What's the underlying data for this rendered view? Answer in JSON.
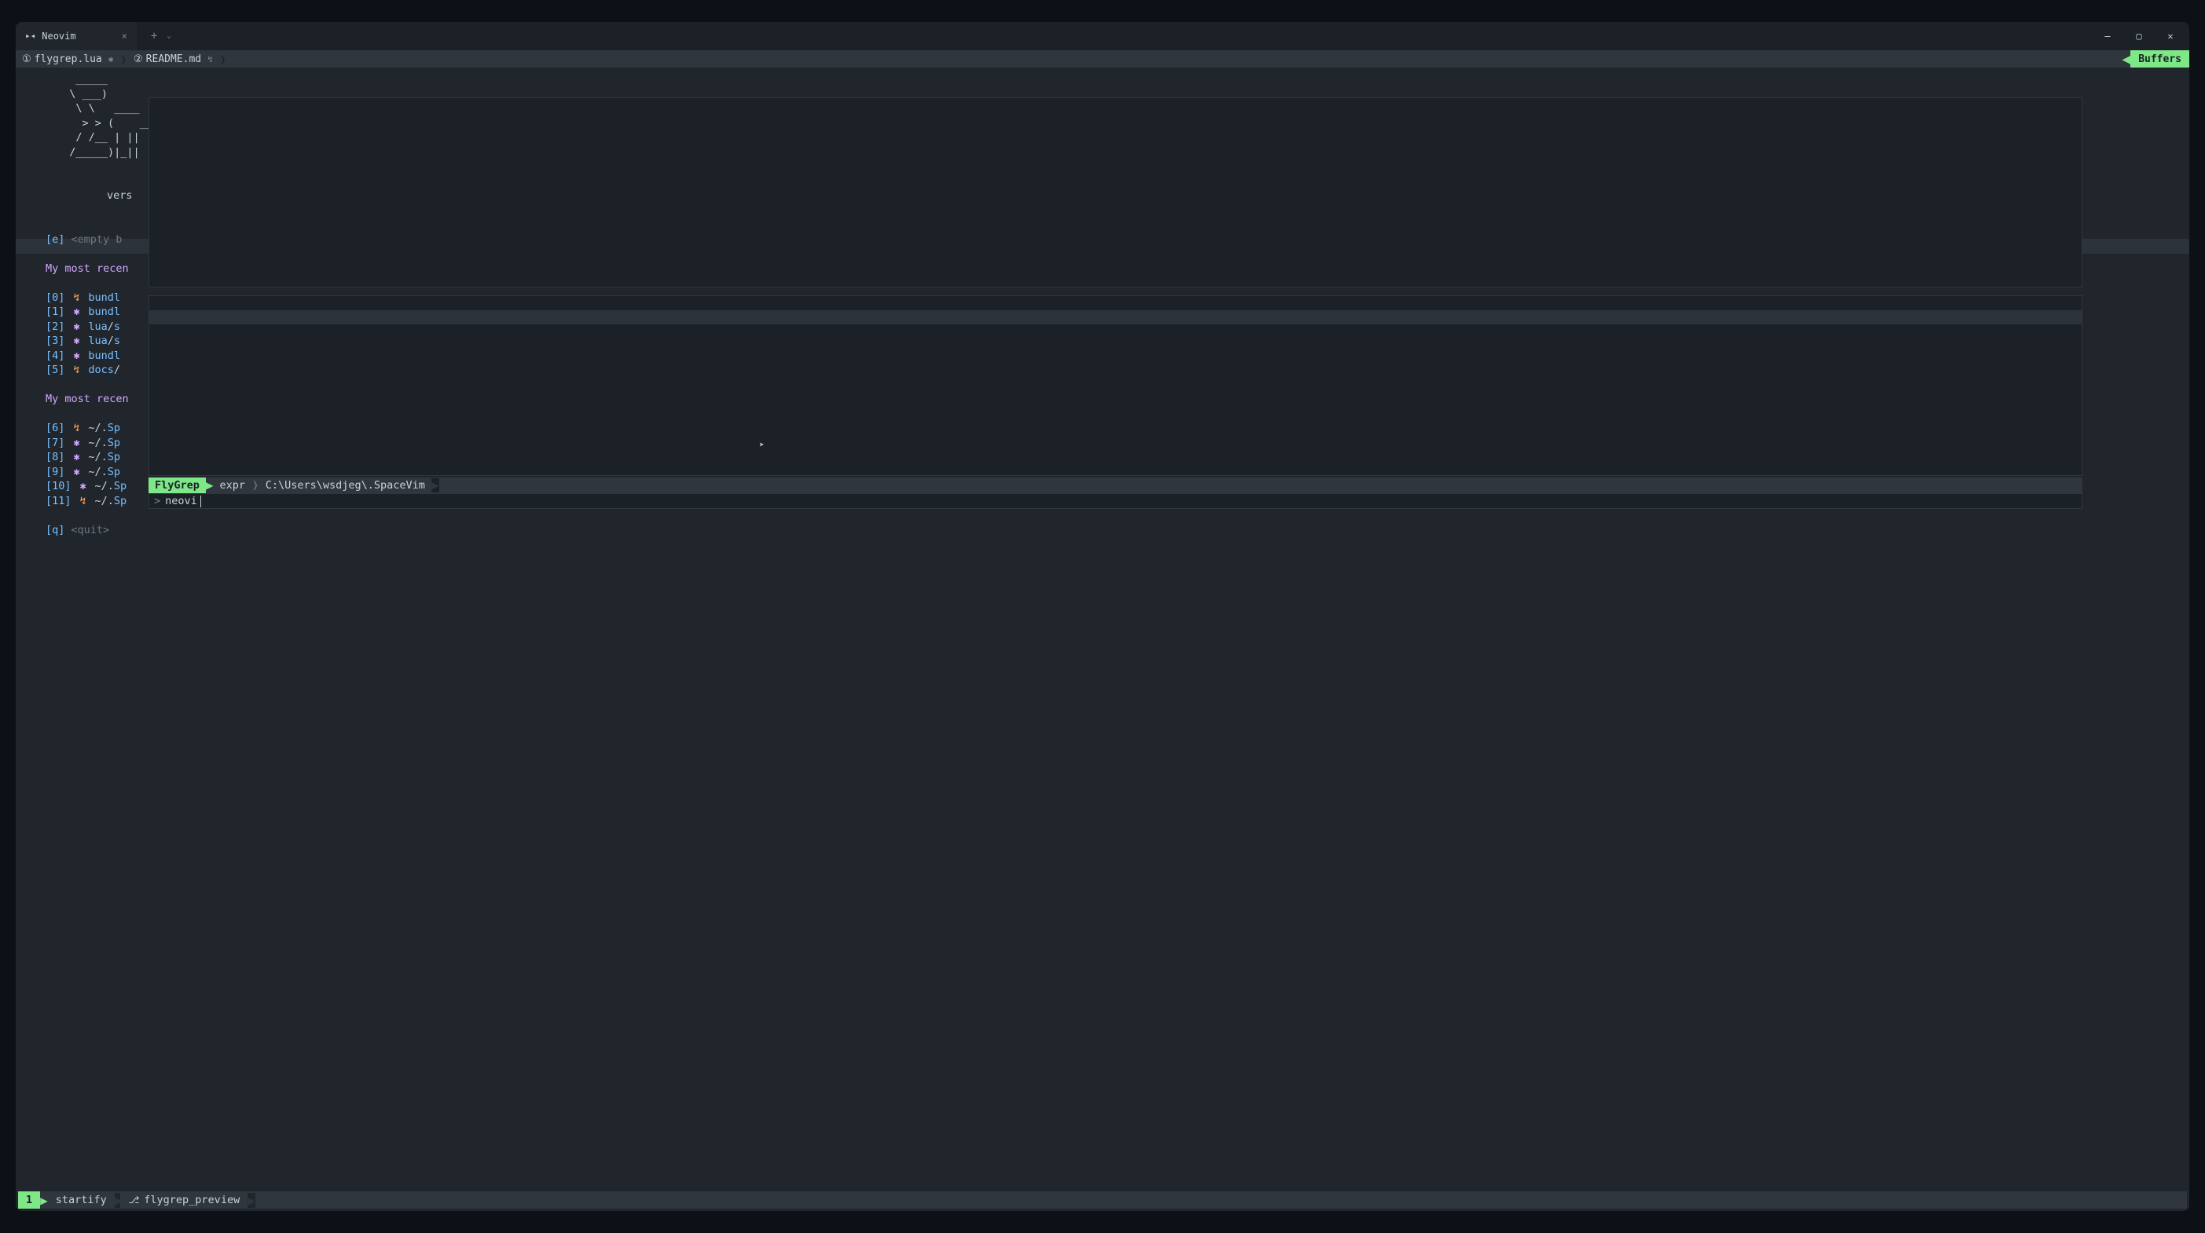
{
  "titlebar": {
    "app_name": "Neovim",
    "close_glyph": "×",
    "new_tab_glyph": "+",
    "dropdown_glyph": "⌄"
  },
  "window_controls": {
    "minimize": "—",
    "maximize": "▢",
    "close": "✕"
  },
  "bufferline": {
    "items": [
      {
        "num": "①",
        "name": "flygrep.lua",
        "modified": "✱"
      },
      {
        "num": "②",
        "name": "README.md",
        "modified": "↯"
      }
    ],
    "right_label": "Buffers"
  },
  "ascii_art": "   _____      \n  \\ ___)     \n   \\ \\   ____\n    > > (    __\n   / /__ | ||\n  /_____)|_||",
  "vers_label": "vers",
  "startify": {
    "empty_key": "[e]",
    "empty_label": "<empty b",
    "section1": "My most recen",
    "section2": "My most recen",
    "quit_key": "[q]",
    "quit_label": "<quit>",
    "recent1": [
      {
        "key": "[0]",
        "icon": "↯",
        "icon_class": "orange",
        "path": "bundl"
      },
      {
        "key": "[1]",
        "icon": "✱",
        "icon_class": "purple",
        "path": "bundl"
      },
      {
        "key": "[2]",
        "icon": "✱",
        "icon_class": "purple",
        "path_pre": "lua",
        "path_post": "s"
      },
      {
        "key": "[3]",
        "icon": "✱",
        "icon_class": "purple",
        "path_pre": "lua",
        "path_post": "s"
      },
      {
        "key": "[4]",
        "icon": "✱",
        "icon_class": "purple",
        "path": "bundl"
      },
      {
        "key": "[5]",
        "icon": "↯",
        "icon_class": "orange",
        "path_pre": "docs",
        "path_post": ""
      }
    ],
    "recent2": [
      {
        "key": "[6]",
        "icon": "↯",
        "icon_class": "orange",
        "path_pre": "~/.",
        "path_post": "Sp"
      },
      {
        "key": "[7]",
        "icon": "✱",
        "icon_class": "purple",
        "path_pre": "~/.",
        "path_post": "Sp"
      },
      {
        "key": "[8]",
        "icon": "✱",
        "icon_class": "purple",
        "path_pre": "~/.",
        "path_post": "Sp"
      },
      {
        "key": "[9]",
        "icon": "✱",
        "icon_class": "purple",
        "path_pre": "~/.",
        "path_post": "Sp"
      },
      {
        "key": "[10]",
        "icon": "✱",
        "icon_class": "purple",
        "path_pre": "~/.",
        "path_post": "Sp"
      },
      {
        "key": "[11]",
        "icon": "↯",
        "icon_class": "orange",
        "path_pre": "~/.",
        "path_post": "Sp"
      }
    ]
  },
  "flygrep": {
    "label": "FlyGrep",
    "mode": "expr",
    "path": "C:\\Users\\wsdjeg\\.SpaceVim",
    "prompt": ">",
    "input": "neovi"
  },
  "statusbar": {
    "mode_num": "1",
    "name": "startify",
    "branch": "flygrep_preview",
    "git_glyph": "⎇"
  },
  "colors": {
    "bg": "#21262d",
    "bg_dark": "#1c2128",
    "accent": "#7ee787",
    "blue": "#79c0ff",
    "purple": "#d2a8ff",
    "orange": "#ffa657"
  }
}
